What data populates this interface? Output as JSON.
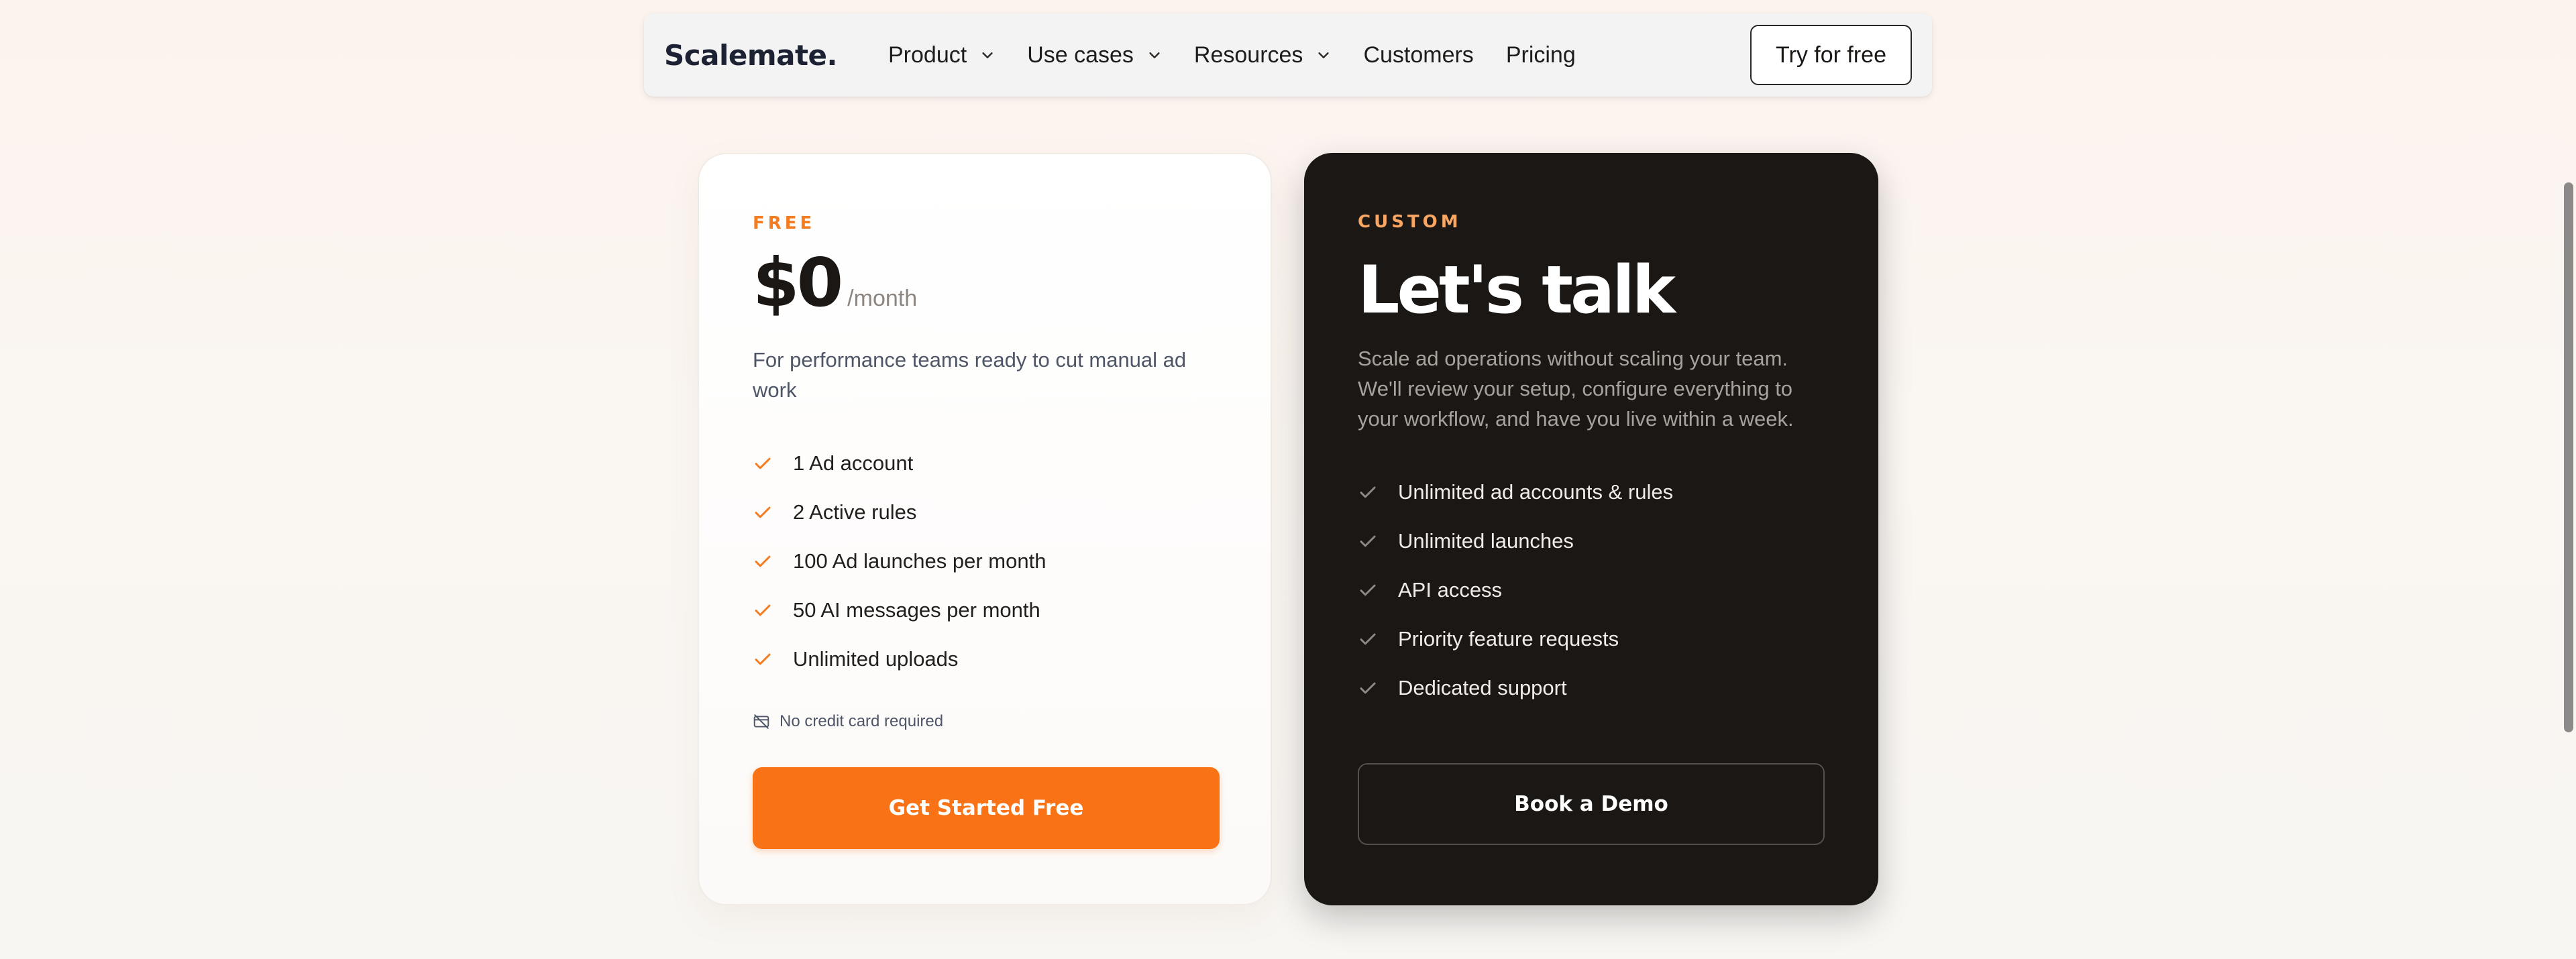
{
  "nav": {
    "brand": "Scalemate.",
    "items": [
      {
        "label": "Product",
        "has_dropdown": true
      },
      {
        "label": "Use cases",
        "has_dropdown": true
      },
      {
        "label": "Resources",
        "has_dropdown": true
      },
      {
        "label": "Customers",
        "has_dropdown": false
      },
      {
        "label": "Pricing",
        "has_dropdown": false
      }
    ],
    "cta": "Try for free"
  },
  "plans": {
    "free": {
      "tier": "FREE",
      "price": "$0",
      "price_unit": "/month",
      "description": "For performance teams ready to cut manual ad work",
      "features": [
        "1 Ad account",
        "2 Active rules",
        "100 Ad launches per month",
        "50 AI messages per month",
        "Unlimited uploads"
      ],
      "note": "No credit card required",
      "cta": "Get Started Free"
    },
    "custom": {
      "tier": "CUSTOM",
      "headline": "Let's talk",
      "description": "Scale ad operations without scaling your team. We'll review your setup, configure everything to your workflow, and have you live within a week.",
      "features": [
        "Unlimited ad accounts & rules",
        "Unlimited launches",
        "API access",
        "Priority feature requests",
        "Dedicated support"
      ],
      "cta": "Book a Demo"
    }
  },
  "icons": {
    "dropdown": "chevron-down-icon",
    "feature": "check-icon",
    "note": "no-credit-card-icon"
  },
  "colors": {
    "accent": "#f97316",
    "accent_label": "#f47b20",
    "custom_label": "#f8a663",
    "dark_card": "#1b1714",
    "brand_text": "#1c2233"
  }
}
